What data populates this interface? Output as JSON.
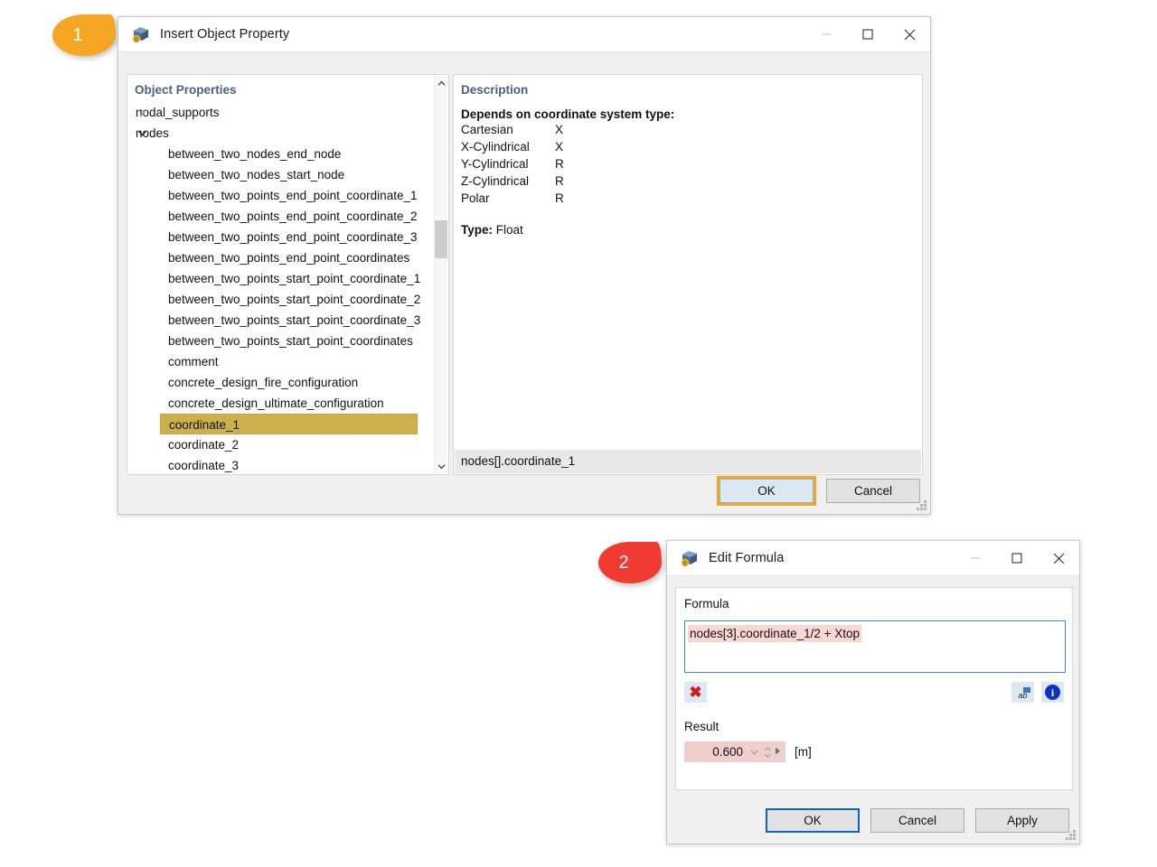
{
  "callouts": [
    {
      "number": "1",
      "color": "#f5a623"
    },
    {
      "number": "2",
      "color": "#ef3b32"
    }
  ],
  "insert_dialog": {
    "title": "Insert Object Property",
    "icon": "app-cube-icon",
    "window_controls": {
      "minimize": "minimize-icon",
      "maximize": "maximize-icon",
      "close": "close-icon"
    },
    "tree_panel": {
      "heading": "Object Properties",
      "items": [
        {
          "label": "nodal_supports",
          "level": 0,
          "state": "collapsed",
          "selected": false
        },
        {
          "label": "nodes",
          "level": 0,
          "state": "expanded",
          "selected": false
        },
        {
          "label": "between_two_nodes_end_node",
          "level": 2,
          "state": "leaf",
          "selected": false
        },
        {
          "label": "between_two_nodes_start_node",
          "level": 2,
          "state": "leaf",
          "selected": false
        },
        {
          "label": "between_two_points_end_point_coordinate_1",
          "level": 2,
          "state": "leaf",
          "selected": false
        },
        {
          "label": "between_two_points_end_point_coordinate_2",
          "level": 2,
          "state": "leaf",
          "selected": false
        },
        {
          "label": "between_two_points_end_point_coordinate_3",
          "level": 2,
          "state": "leaf",
          "selected": false
        },
        {
          "label": "between_two_points_end_point_coordinates",
          "level": 2,
          "state": "leaf",
          "selected": false
        },
        {
          "label": "between_two_points_start_point_coordinate_1",
          "level": 2,
          "state": "leaf",
          "selected": false
        },
        {
          "label": "between_two_points_start_point_coordinate_2",
          "level": 2,
          "state": "leaf",
          "selected": false
        },
        {
          "label": "between_two_points_start_point_coordinate_3",
          "level": 2,
          "state": "leaf",
          "selected": false
        },
        {
          "label": "between_two_points_start_point_coordinates",
          "level": 2,
          "state": "leaf",
          "selected": false
        },
        {
          "label": "comment",
          "level": 2,
          "state": "leaf",
          "selected": false
        },
        {
          "label": "concrete_design_fire_configuration",
          "level": 2,
          "state": "leaf",
          "selected": false
        },
        {
          "label": "concrete_design_ultimate_configuration",
          "level": 2,
          "state": "leaf",
          "selected": false
        },
        {
          "label": "coordinate_1",
          "level": 2,
          "state": "leaf",
          "selected": true
        },
        {
          "label": "coordinate_2",
          "level": 2,
          "state": "leaf",
          "selected": false
        },
        {
          "label": "coordinate_3",
          "level": 2,
          "state": "leaf",
          "selected": false
        }
      ],
      "selection_bg": "#cdb04e",
      "selection_border": "#e08a10"
    },
    "description_panel": {
      "heading": "Description",
      "depends_heading": "Depends on coordinate system type:",
      "rows": [
        {
          "system": "Cartesian",
          "value": "X"
        },
        {
          "system": "X-Cylindrical",
          "value": "X"
        },
        {
          "system": "Y-Cylindrical",
          "value": "R"
        },
        {
          "system": "Z-Cylindrical",
          "value": "R"
        },
        {
          "system": "Polar",
          "value": "R"
        }
      ],
      "type_label": "Type:",
      "type_value": "Float",
      "path": "nodes[].coordinate_1"
    },
    "buttons": {
      "ok": "OK",
      "cancel": "Cancel"
    }
  },
  "formula_dialog": {
    "title": "Edit Formula",
    "icon": "app-cube-icon",
    "window_controls": {
      "minimize": "minimize-icon",
      "maximize": "maximize-icon",
      "close": "close-icon"
    },
    "formula_label": "Formula",
    "formula_value": "nodes[3].coordinate_1/2 + Xtop",
    "error_highlight": "#fbd7d3",
    "toolbar": {
      "delete": "red-x-icon",
      "text_format": "ab-format-icon",
      "info": "info-icon"
    },
    "result_label": "Result",
    "result_value": "0.600",
    "result_unit": "[m]",
    "buttons": {
      "ok": "OK",
      "cancel": "Cancel",
      "apply": "Apply"
    }
  }
}
